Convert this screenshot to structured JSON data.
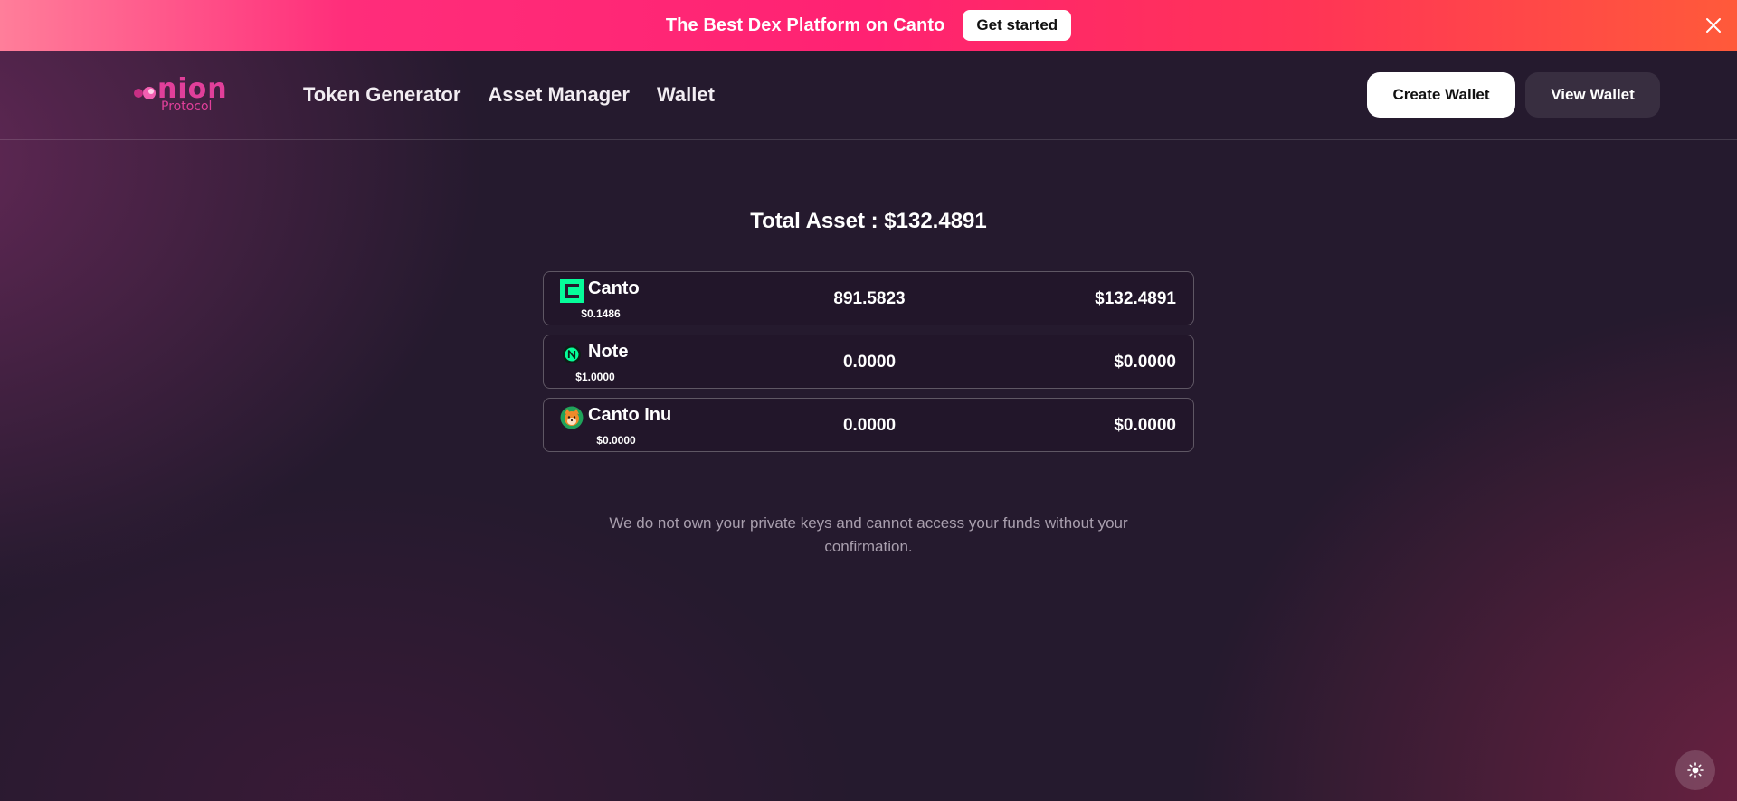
{
  "banner": {
    "text": "The Best Dex Platform on Canto",
    "cta_label": "Get started",
    "close_icon": "close-icon",
    "colors": {
      "start": "#ff7e9a",
      "mid": "#ff2272",
      "end": "#ff5a3a"
    }
  },
  "header": {
    "logo": {
      "word": "nion",
      "sub": "Protocol",
      "color": "#e13f9a"
    },
    "nav": [
      {
        "label": "Token Generator"
      },
      {
        "label": "Asset Manager"
      },
      {
        "label": "Wallet"
      }
    ],
    "create_wallet_label": "Create Wallet",
    "view_wallet_label": "View Wallet"
  },
  "main": {
    "total_label": "Total Asset : $132.4891",
    "assets": [
      {
        "name": "Canto",
        "price": "$0.1486",
        "balance": "891.5823",
        "value": "$132.4891",
        "icon": "canto-logo-icon"
      },
      {
        "name": "Note",
        "price": "$1.0000",
        "balance": "0.0000",
        "value": "$0.0000",
        "icon": "note-logo-icon"
      },
      {
        "name": "Canto Inu",
        "price": "$0.0000",
        "balance": "0.0000",
        "value": "$0.0000",
        "icon": "canto-inu-logo-icon"
      }
    ],
    "disclaimer": "We do not own your private keys and cannot access your funds without your confirmation."
  },
  "footer": {
    "theme_toggle_icon": "sun-icon"
  },
  "colors": {
    "background": "#251a2e",
    "accent_pink": "#e13f9a",
    "canto_green": "#06fc99"
  }
}
